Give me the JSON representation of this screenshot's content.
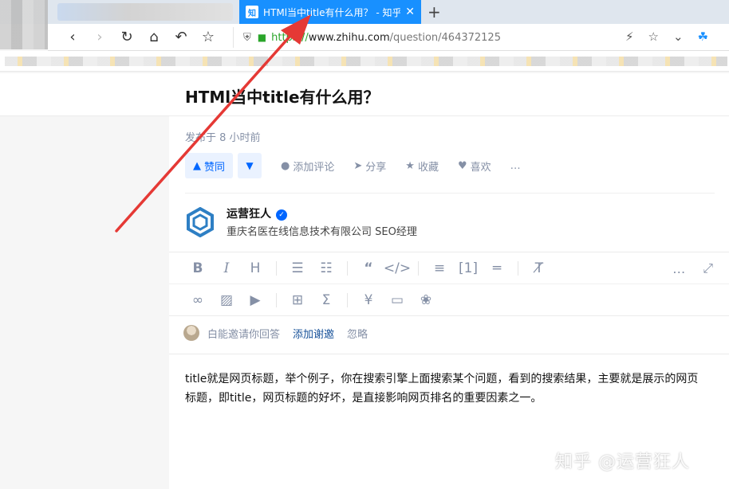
{
  "browser": {
    "active_tab": {
      "favicon_text": "知",
      "title": "HTMl当中title有什么用？ - 知乎",
      "close_label": "✕"
    },
    "new_tab_label": "+",
    "url": {
      "scheme": "https://",
      "host": "www.zhihu.com",
      "path": "/question/464372125"
    }
  },
  "question": {
    "title": "HTMl当中title有什么用？"
  },
  "answer": {
    "time": "发布于 8 小时前",
    "vote_up_label": "赞同",
    "actions": {
      "comment": "添加评论",
      "share": "分享",
      "collect": "收藏",
      "like": "喜欢"
    },
    "author": {
      "name": "运营狂人",
      "description": "重庆名医在线信息技术有限公司 SEO经理"
    },
    "invite": {
      "text": "白能邀请你回答",
      "add_thanks": "添加谢邀",
      "ignore": "忽略"
    },
    "body": "title就是网页标题，举个例子，你在搜索引擎上面搜索某个问题，看到的搜索结果，主要就是展示的网页标题，即title，网页标题的好坏，是直接影响网页排名的重要因素之一。"
  },
  "watermark": "知乎 @运营狂人",
  "colors": {
    "tab_active": "#1890ff",
    "vote_bg": "#eaf2ff",
    "vote_fg": "#0066ff",
    "link": "#175199",
    "arrow": "#e53935",
    "secure_green": "#2aa52a"
  }
}
